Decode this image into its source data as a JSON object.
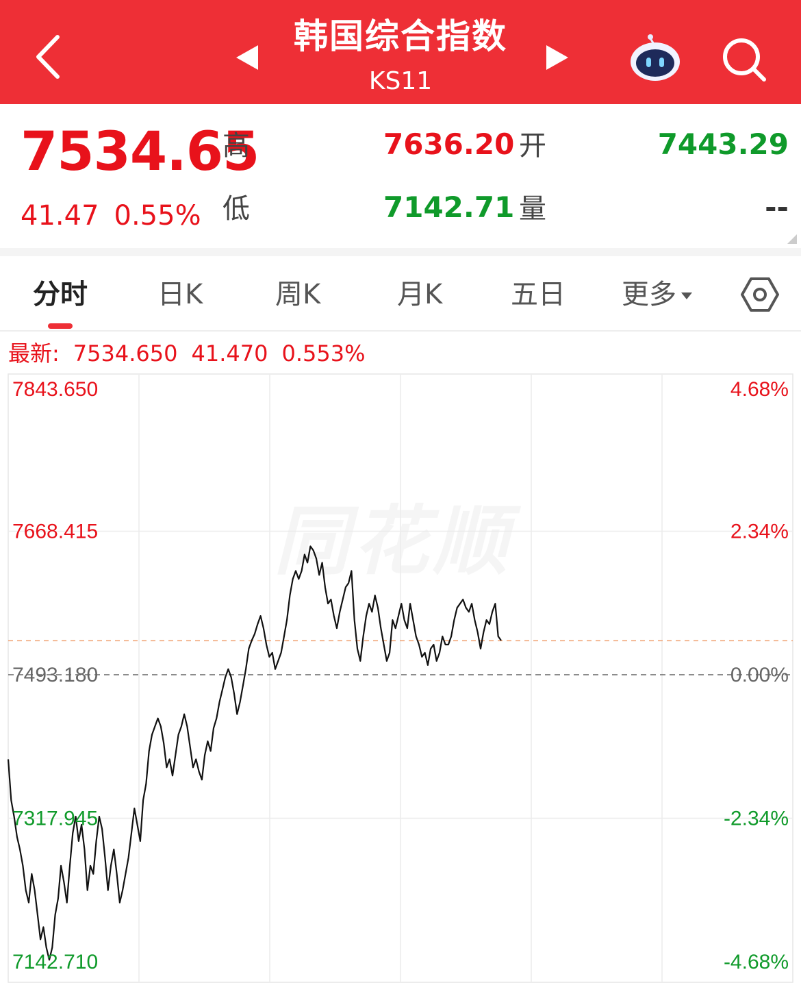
{
  "header": {
    "title": "韩国综合指数",
    "code": "KS11"
  },
  "quote": {
    "price": "7534.65",
    "change": "41.47",
    "change_pct": "0.55%",
    "high_label": "高",
    "high": "7636.20",
    "low_label": "低",
    "low": "7142.71",
    "open_label": "开",
    "open": "7443.29",
    "volume_label": "量",
    "volume": "--"
  },
  "tabs": [
    {
      "label": "分时"
    },
    {
      "label": "日K"
    },
    {
      "label": "周K"
    },
    {
      "label": "月K"
    },
    {
      "label": "五日"
    },
    {
      "label": "更多"
    }
  ],
  "latest": {
    "label": "最新:",
    "price": "7534.650",
    "change": "41.470",
    "pct": "0.553%"
  },
  "watermark": "同花顺",
  "colors": {
    "header": "#ee2f36",
    "up": "#e8121b",
    "down": "#0f9a2a"
  },
  "chart_data": {
    "type": "line",
    "prev_close": 7493.18,
    "ylim": [
      7142.71,
      7843.65
    ],
    "y_ticks_left": [
      "7843.650",
      "7668.415",
      "7493.180",
      "7317.945",
      "7142.710"
    ],
    "y_ticks_right": [
      "4.68%",
      "2.34%",
      "0.00%",
      "-2.34%",
      "-4.68%"
    ],
    "latest_price": 7534.65,
    "series": [
      {
        "values": [
          7390,
          7340,
          7320,
          7295,
          7280,
          7260,
          7230,
          7215,
          7250,
          7230,
          7200,
          7170,
          7185,
          7160,
          7145,
          7160,
          7200,
          7220,
          7260,
          7240,
          7215,
          7260,
          7300,
          7320,
          7290,
          7310,
          7280,
          7230,
          7260,
          7250,
          7290,
          7320,
          7305,
          7270,
          7230,
          7260,
          7280,
          7250,
          7215,
          7230,
          7250,
          7270,
          7300,
          7330,
          7310,
          7290,
          7340,
          7360,
          7400,
          7420,
          7430,
          7440,
          7430,
          7410,
          7380,
          7390,
          7370,
          7395,
          7420,
          7430,
          7445,
          7430,
          7405,
          7380,
          7390,
          7375,
          7365,
          7395,
          7412,
          7400,
          7428,
          7440,
          7460,
          7475,
          7490,
          7500,
          7490,
          7470,
          7445,
          7460,
          7480,
          7500,
          7525,
          7535,
          7543,
          7555,
          7565,
          7550,
          7530,
          7515,
          7520,
          7500,
          7510,
          7520,
          7540,
          7560,
          7590,
          7610,
          7620,
          7610,
          7620,
          7640,
          7630,
          7650,
          7645,
          7635,
          7615,
          7630,
          7600,
          7580,
          7585,
          7565,
          7550,
          7570,
          7585,
          7600,
          7605,
          7620,
          7560,
          7525,
          7510,
          7540,
          7565,
          7580,
          7570,
          7590,
          7575,
          7550,
          7530,
          7510,
          7520,
          7560,
          7550,
          7565,
          7580,
          7560,
          7550,
          7580,
          7560,
          7540,
          7530,
          7515,
          7520,
          7505,
          7525,
          7530,
          7510,
          7520,
          7540,
          7530,
          7530,
          7540,
          7560,
          7575,
          7580,
          7585,
          7575,
          7570,
          7580,
          7560,
          7545,
          7525,
          7545,
          7560,
          7555,
          7570,
          7580,
          7540,
          7535
        ]
      }
    ]
  }
}
